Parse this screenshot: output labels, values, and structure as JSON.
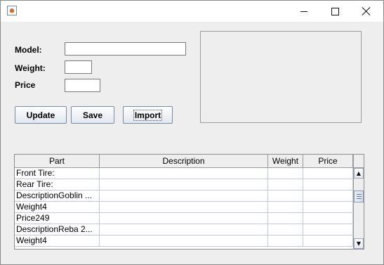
{
  "window": {
    "title": "",
    "controls": {
      "minimize": "minimize-icon",
      "maximize": "maximize-icon",
      "close": "close-icon"
    }
  },
  "form": {
    "model_label": "Model:",
    "model_value": "",
    "weight_label": "Weight:",
    "weight_value": "",
    "price_label": "Price",
    "price_value": ""
  },
  "buttons": {
    "update": "Update",
    "save": "Save",
    "import": "Import"
  },
  "table": {
    "columns": [
      "Part",
      "Description",
      "Weight",
      "Price"
    ],
    "rows": [
      [
        "Front Tire:",
        "",
        "",
        ""
      ],
      [
        "Rear Tire:",
        "",
        "",
        ""
      ],
      [
        "DescriptionGoblin ...",
        "",
        "",
        ""
      ],
      [
        "Weight4",
        "",
        "",
        ""
      ],
      [
        "Price249",
        "",
        "",
        ""
      ],
      [
        "DescriptionReba 2...",
        "",
        "",
        ""
      ],
      [
        "Weight4",
        "",
        "",
        ""
      ]
    ]
  },
  "scrollbar": {
    "up": "scroll-up-arrow-icon",
    "down": "scroll-down-arrow-icon"
  },
  "colors": {
    "window_bg": "#eeeeee",
    "button_border": "#7a8aa0",
    "grid": "#c3cad4"
  }
}
